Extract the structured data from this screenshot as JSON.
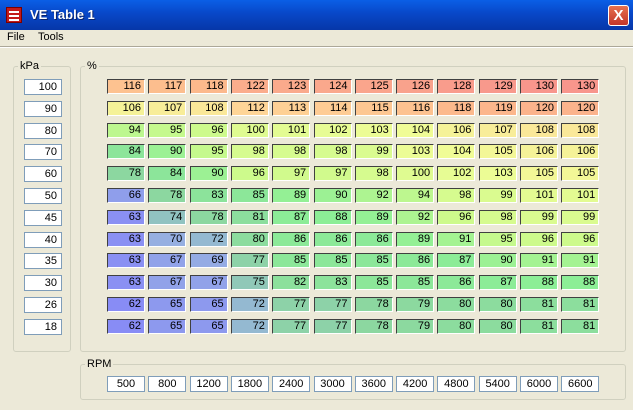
{
  "window": {
    "title": "VE Table 1",
    "close_label": "X"
  },
  "menu": {
    "items": [
      "File",
      "Tools"
    ]
  },
  "kpa_panel": {
    "label": "kPa",
    "values": [
      "100",
      "90",
      "80",
      "70",
      "60",
      "50",
      "45",
      "40",
      "35",
      "30",
      "26",
      "18"
    ]
  },
  "table_panel": {
    "label": "%"
  },
  "rpm_panel": {
    "label": "RPM",
    "values": [
      "500",
      "800",
      "1200",
      "1800",
      "2400",
      "3000",
      "3600",
      "4200",
      "4800",
      "5400",
      "6000",
      "6600"
    ]
  },
  "ve_table": [
    [
      "116",
      "117",
      "118",
      "122",
      "123",
      "124",
      "125",
      "126",
      "128",
      "129",
      "130",
      "130"
    ],
    [
      "106",
      "107",
      "108",
      "112",
      "113",
      "114",
      "115",
      "116",
      "118",
      "119",
      "120",
      "120"
    ],
    [
      "94",
      "95",
      "96",
      "100",
      "101",
      "102",
      "103",
      "104",
      "106",
      "107",
      "108",
      "108"
    ],
    [
      "84",
      "90",
      "95",
      "98",
      "98",
      "98",
      "99",
      "103",
      "104",
      "105",
      "106",
      "106"
    ],
    [
      "78",
      "84",
      "90",
      "96",
      "97",
      "97",
      "98",
      "100",
      "102",
      "103",
      "105",
      "105"
    ],
    [
      "66",
      "78",
      "83",
      "85",
      "89",
      "90",
      "92",
      "94",
      "98",
      "99",
      "101",
      "101"
    ],
    [
      "63",
      "74",
      "78",
      "81",
      "87",
      "88",
      "89",
      "92",
      "96",
      "98",
      "99",
      "99"
    ],
    [
      "63",
      "70",
      "72",
      "80",
      "86",
      "86",
      "86",
      "89",
      "91",
      "95",
      "96",
      "96"
    ],
    [
      "63",
      "67",
      "69",
      "77",
      "85",
      "85",
      "85",
      "86",
      "87",
      "90",
      "91",
      "91"
    ],
    [
      "63",
      "67",
      "67",
      "75",
      "82",
      "83",
      "85",
      "85",
      "86",
      "87",
      "88",
      "88"
    ],
    [
      "62",
      "65",
      "65",
      "72",
      "77",
      "77",
      "78",
      "79",
      "80",
      "80",
      "81",
      "81"
    ],
    [
      "62",
      "65",
      "65",
      "72",
      "77",
      "77",
      "78",
      "79",
      "80",
      "80",
      "81",
      "81"
    ]
  ]
}
